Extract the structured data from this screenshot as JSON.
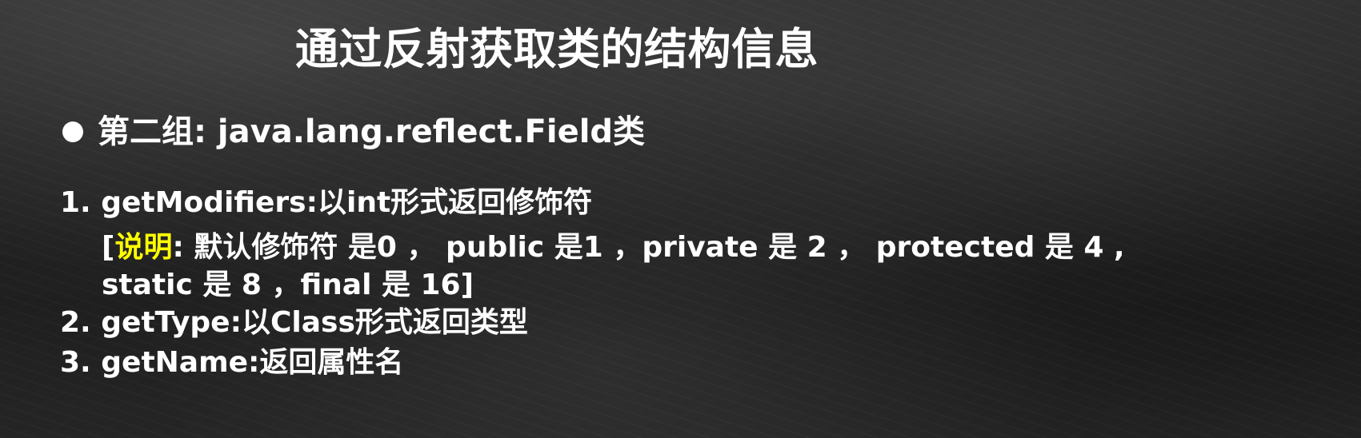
{
  "slide": {
    "title": "通过反射获取类的结构信息",
    "bullet": "第二组: java.lang.reflect.Field类",
    "items": [
      {
        "text": "1. getModifiers:以int形式返回修饰符"
      },
      {
        "prefix": "[",
        "highlight": "说明",
        "suffix": ": 默认修饰符 是0 ， public  是1 ，private 是 2 ， protected 是 4 ,"
      },
      {
        "text": "static 是 8 ，final 是 16]"
      },
      {
        "text": "2. getType:以Class形式返回类型"
      },
      {
        "text": "3. getName:返回属性名"
      }
    ],
    "colors": {
      "background": "#262626",
      "text": "#ffffff",
      "highlight": "#ffff00"
    }
  }
}
